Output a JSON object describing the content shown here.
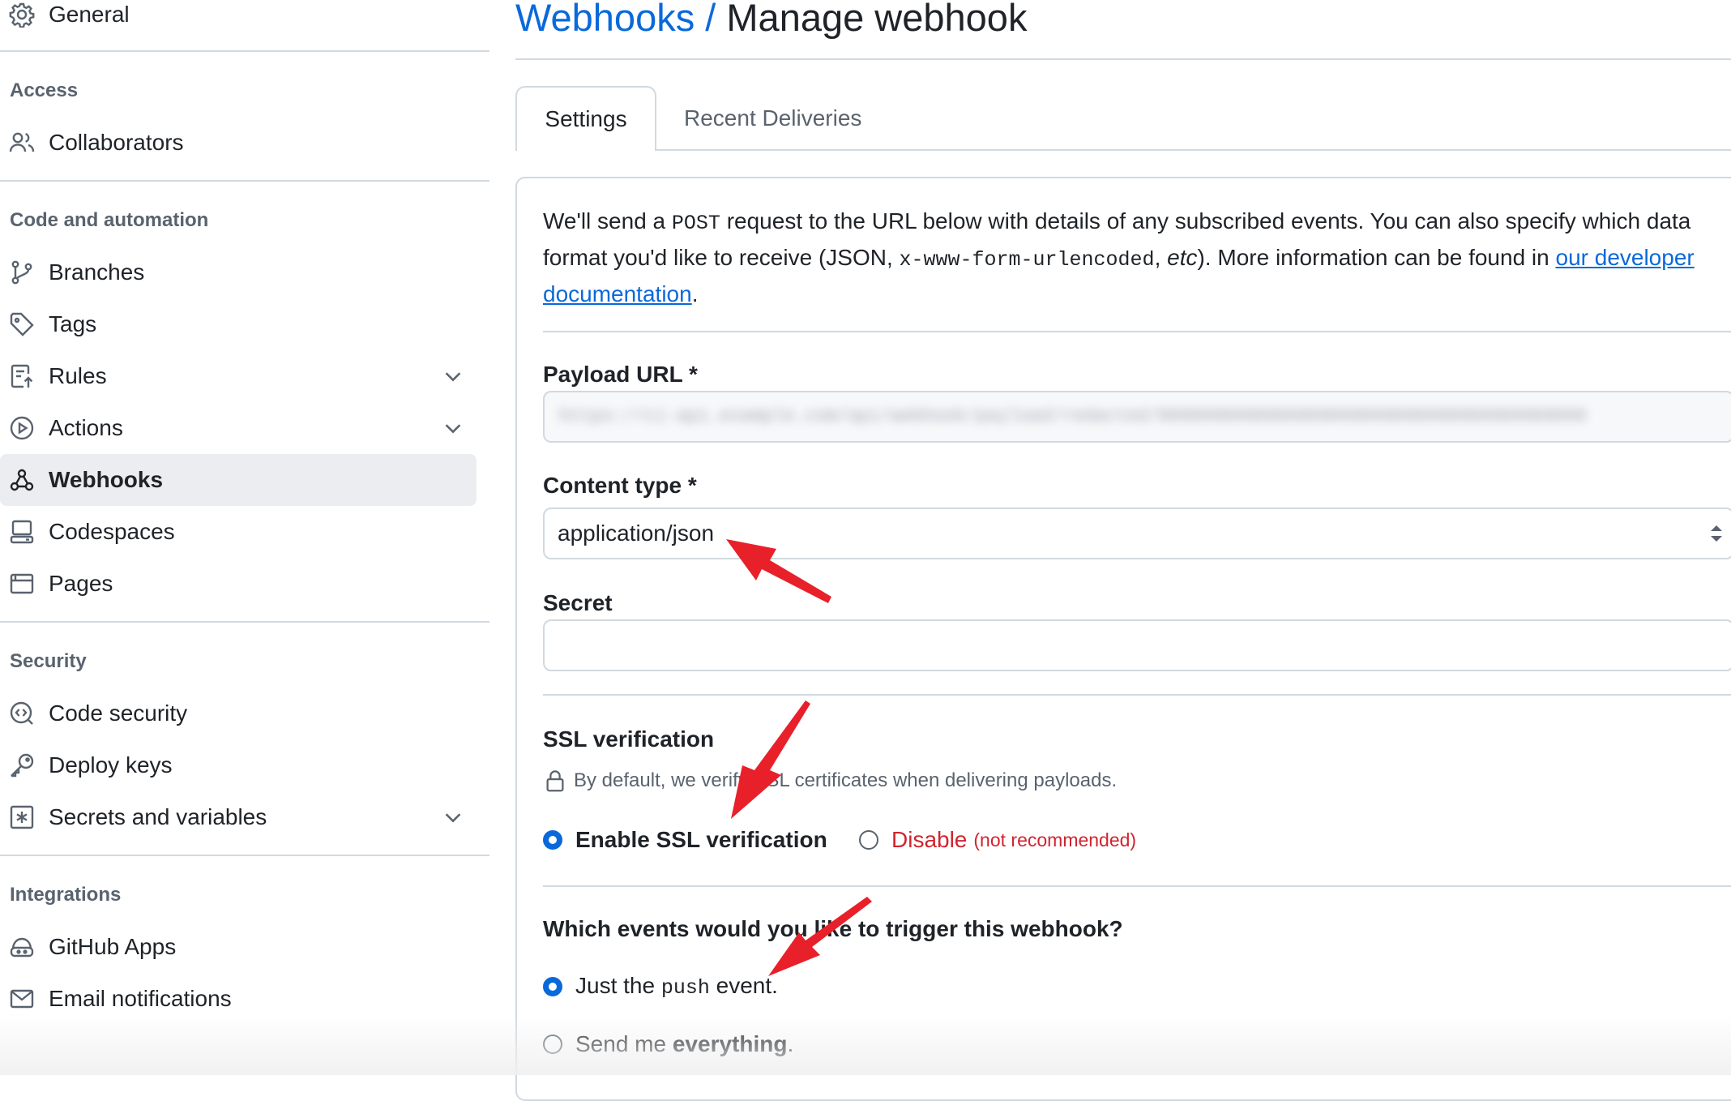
{
  "sidebar": {
    "top_item": {
      "label": "General",
      "icon": "gear-icon"
    },
    "sections": {
      "access": {
        "heading": "Access",
        "items": [
          {
            "label": "Collaborators",
            "icon": "people-icon"
          }
        ]
      },
      "code": {
        "heading": "Code and automation",
        "items": [
          {
            "label": "Branches",
            "icon": "git-branch-icon"
          },
          {
            "label": "Tags",
            "icon": "tag-icon"
          },
          {
            "label": "Rules",
            "icon": "rules-icon",
            "expandable": true
          },
          {
            "label": "Actions",
            "icon": "play-icon",
            "expandable": true
          },
          {
            "label": "Webhooks",
            "icon": "webhook-icon",
            "active": true
          },
          {
            "label": "Codespaces",
            "icon": "codespaces-icon"
          },
          {
            "label": "Pages",
            "icon": "browser-icon"
          }
        ]
      },
      "security": {
        "heading": "Security",
        "items": [
          {
            "label": "Code security",
            "icon": "codescan-icon"
          },
          {
            "label": "Deploy keys",
            "icon": "key-icon"
          },
          {
            "label": "Secrets and variables",
            "icon": "key-asterisk-icon",
            "expandable": true
          }
        ]
      },
      "integrations": {
        "heading": "Integrations",
        "items": [
          {
            "label": "GitHub Apps",
            "icon": "apps-icon"
          },
          {
            "label": "Email notifications",
            "icon": "mail-icon"
          }
        ]
      }
    }
  },
  "header": {
    "breadcrumb": "Webhooks",
    "separator": " / ",
    "title": "Manage webhook"
  },
  "tabs": [
    {
      "label": "Settings",
      "active": true
    },
    {
      "label": "Recent Deliveries",
      "active": false
    }
  ],
  "intro": {
    "part1": "We'll send a ",
    "code1": "POST",
    "part2": " request to the URL below with details of any subscribed events. You can also specify which data format you'd like to receive (JSON, ",
    "code2": "x-www-form-urlencoded",
    "part3": ", ",
    "etc": "etc",
    "part4": "). More information can be found in ",
    "link": "our developer documentation",
    "part5": "."
  },
  "form": {
    "payload_label": "Payload URL *",
    "payload_value_blurred": "https://ci-api.example.com/api/webhook/payload/redacted/0000000000000000000000000000000000000000",
    "content_type_label": "Content type *",
    "content_type_value": "application/json",
    "secret_label": "Secret",
    "secret_value": "",
    "ssl": {
      "heading": "SSL verification",
      "hint": "By default, we verify SSL certificates when delivering payloads.",
      "enable_label": "Enable SSL verification",
      "disable_label": "Disable",
      "disable_note": "(not recommended)",
      "selected": "enable"
    },
    "events": {
      "heading": "Which events would you like to trigger this webhook?",
      "option1_pre": "Just the ",
      "option1_code": "push",
      "option1_post": " event.",
      "option2_pre": "Send me ",
      "option2_bold": "everything",
      "option2_post": ".",
      "selected": "push"
    }
  },
  "colors": {
    "accent": "#0969da",
    "danger": "#d1242f",
    "annotation": "#e8202a",
    "active_bg": "#ebedf0"
  }
}
